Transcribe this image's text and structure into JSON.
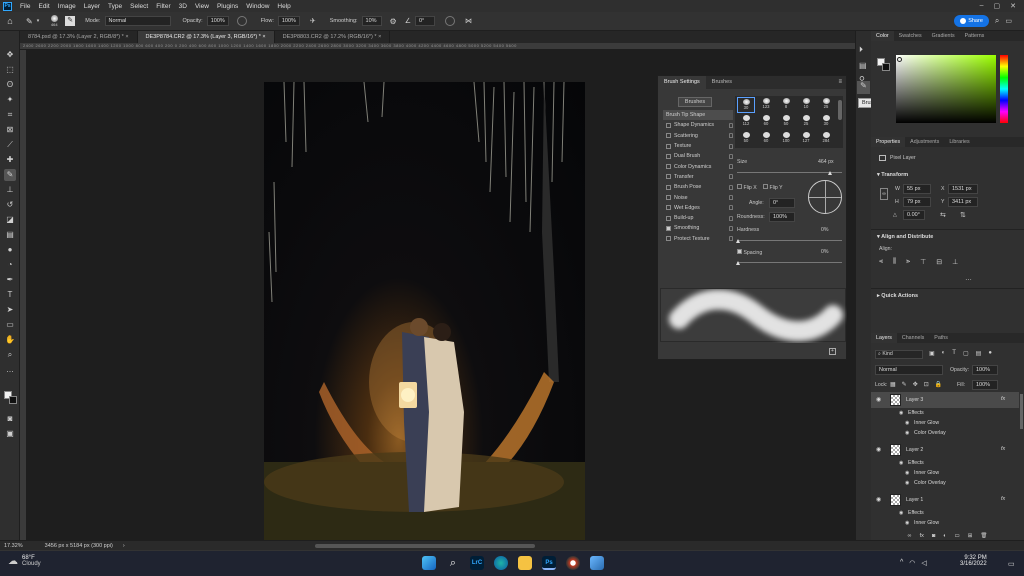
{
  "menu": [
    "File",
    "Edit",
    "Image",
    "Layer",
    "Type",
    "Select",
    "Filter",
    "3D",
    "View",
    "Plugins",
    "Window",
    "Help"
  ],
  "options": {
    "brush_size": "464",
    "mode_label": "Mode:",
    "mode_value": "Normal",
    "opacity_label": "Opacity:",
    "opacity_value": "100%",
    "flow_label": "Flow:",
    "flow_value": "100%",
    "smoothing_label": "Smoothing:",
    "smoothing_value": "10%",
    "angle_value": "0°",
    "share_label": "Share"
  },
  "tabs": [
    "8784.psd @ 17.3% (Layer 2, RGB/8*) *",
    "DE3P8784.CR2 @ 17.3% (Layer 3, RGB/16*) *",
    "DE3P8803.CR2 @ 17.2% (RGB/16*) *"
  ],
  "ruler_numbers": "2400  2600  2200  2000  1800  1600  1400  1200  1000  800  600  400  200  0  200  400  600  800  1000  1200  1400  1600  1800  2000  2200  2400  2600  2800  3000  3200  3400  3600  3800  4000  4200  4400  4600  4800  5000  5200  5400  5600",
  "status": {
    "zoom": "17.32%",
    "doc_info": "3456 px x 5184 px (300 ppi)"
  },
  "brush_settings": {
    "tabs": [
      "Brush Settings",
      "Brushes"
    ],
    "brushes_button": "Brushes",
    "items": [
      {
        "label": "Brush Tip Shape",
        "checked": null,
        "selected": true
      },
      {
        "label": "Shape Dynamics",
        "checked": false
      },
      {
        "label": "Scattering",
        "checked": false
      },
      {
        "label": "Texture",
        "checked": false
      },
      {
        "label": "Dual Brush",
        "checked": false
      },
      {
        "label": "Color Dynamics",
        "checked": false
      },
      {
        "label": "Transfer",
        "checked": false
      },
      {
        "label": "Brush Pose",
        "checked": false
      },
      {
        "label": "Noise",
        "checked": false
      },
      {
        "label": "Wet Edges",
        "checked": false
      },
      {
        "label": "Build-up",
        "checked": false
      },
      {
        "label": "Smoothing",
        "checked": true
      },
      {
        "label": "Protect Texture",
        "checked": false
      }
    ],
    "presets": [
      "30",
      "123",
      "8",
      "10",
      "25",
      "112",
      "60",
      "50",
      "25",
      "30",
      "50",
      "60",
      "100",
      "127",
      "284"
    ],
    "size_label": "Size",
    "size_value": "464 px",
    "flip_x": "Flip X",
    "flip_y": "Flip Y",
    "angle_label": "Angle:",
    "angle_value": "0°",
    "roundness_label": "Roundness:",
    "roundness_value": "100%",
    "hardness_label": "Hardness",
    "hardness_value": "0%",
    "spacing_label": "Spacing",
    "spacing_value": "0%"
  },
  "tooltip": "Brush Settings",
  "color_panel": {
    "tabs": [
      "Color",
      "Swatches",
      "Gradients",
      "Patterns"
    ]
  },
  "properties": {
    "tabs": [
      "Properties",
      "Adjustments",
      "Libraries"
    ],
    "kind": "Pixel Layer",
    "transform_title": "Transform",
    "w": "55 px",
    "x": "1531 px",
    "h": "79 px",
    "y": "3411 px",
    "angle": "0.00°",
    "align_title": "Align and Distribute",
    "align_label": "Align:",
    "quick_actions": "Quick Actions"
  },
  "layers": {
    "tabs": [
      "Layers",
      "Channels",
      "Paths"
    ],
    "kind_filter": "Kind",
    "blend_mode": "Normal",
    "opacity_label": "Opacity:",
    "opacity_value": "100%",
    "lock_label": "Lock:",
    "fill_label": "Fill:",
    "fill_value": "100%",
    "items": [
      {
        "name": "Layer 3",
        "effects": [
          "Effects",
          "Inner Glow",
          "Color Overlay"
        ]
      },
      {
        "name": "Layer 2",
        "effects": [
          "Effects",
          "Inner Glow",
          "Color Overlay"
        ]
      },
      {
        "name": "Layer 1",
        "effects": [
          "Effects",
          "Inner Glow"
        ]
      }
    ]
  },
  "taskbar": {
    "temp": "68°F",
    "weather": "Cloudy",
    "time": "9:32 PM",
    "date": "3/16/2022"
  }
}
